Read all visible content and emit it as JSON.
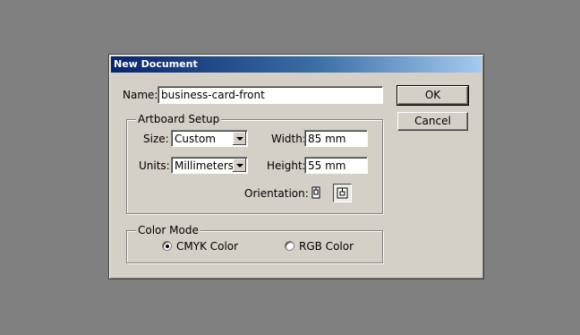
{
  "dialog": {
    "title": "New Document"
  },
  "name": {
    "label": "Name:",
    "value": "business-card-front"
  },
  "buttons": {
    "ok": "OK",
    "cancel": "Cancel"
  },
  "artboard": {
    "legend": "Artboard Setup",
    "size_label": "Size:",
    "size_value": "Custom",
    "units_label": "Units:",
    "units_value": "Millimeters",
    "width_label": "Width:",
    "width_value": "85 mm",
    "height_label": "Height:",
    "height_value": "55 mm",
    "orientation_label": "Orientation:",
    "orientation_selected": "landscape",
    "icons": [
      "portrait-orientation-icon",
      "landscape-orientation-icon"
    ]
  },
  "color_mode": {
    "legend": "Color Mode",
    "options": [
      {
        "label": "CMYK Color",
        "checked": true
      },
      {
        "label": "RGB Color",
        "checked": false
      }
    ]
  }
}
